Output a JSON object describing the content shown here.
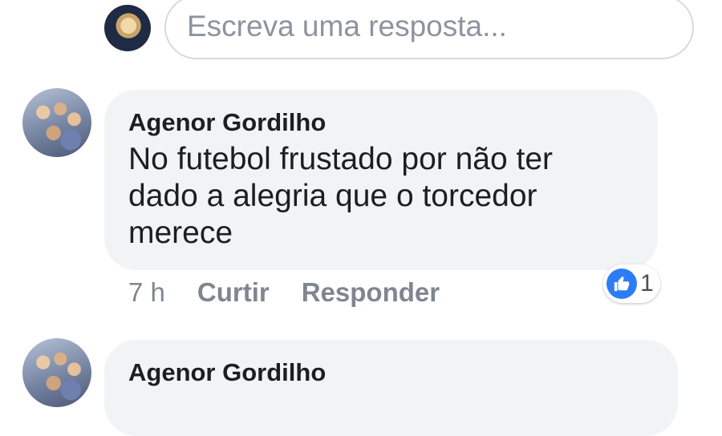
{
  "reply": {
    "placeholder": "Escreva uma resposta..."
  },
  "comments": [
    {
      "author": "Agenor Gordilho",
      "text": "No futebol frustado por não ter\ndado a alegria que o torcedor\nmerece",
      "time": "7 h",
      "like_label": "Curtir",
      "reply_label": "Responder",
      "reaction_count": "1",
      "reaction_icon": "like-icon",
      "reaction_color": "#2d7cf6"
    },
    {
      "author": "Agenor Gordilho"
    }
  ]
}
